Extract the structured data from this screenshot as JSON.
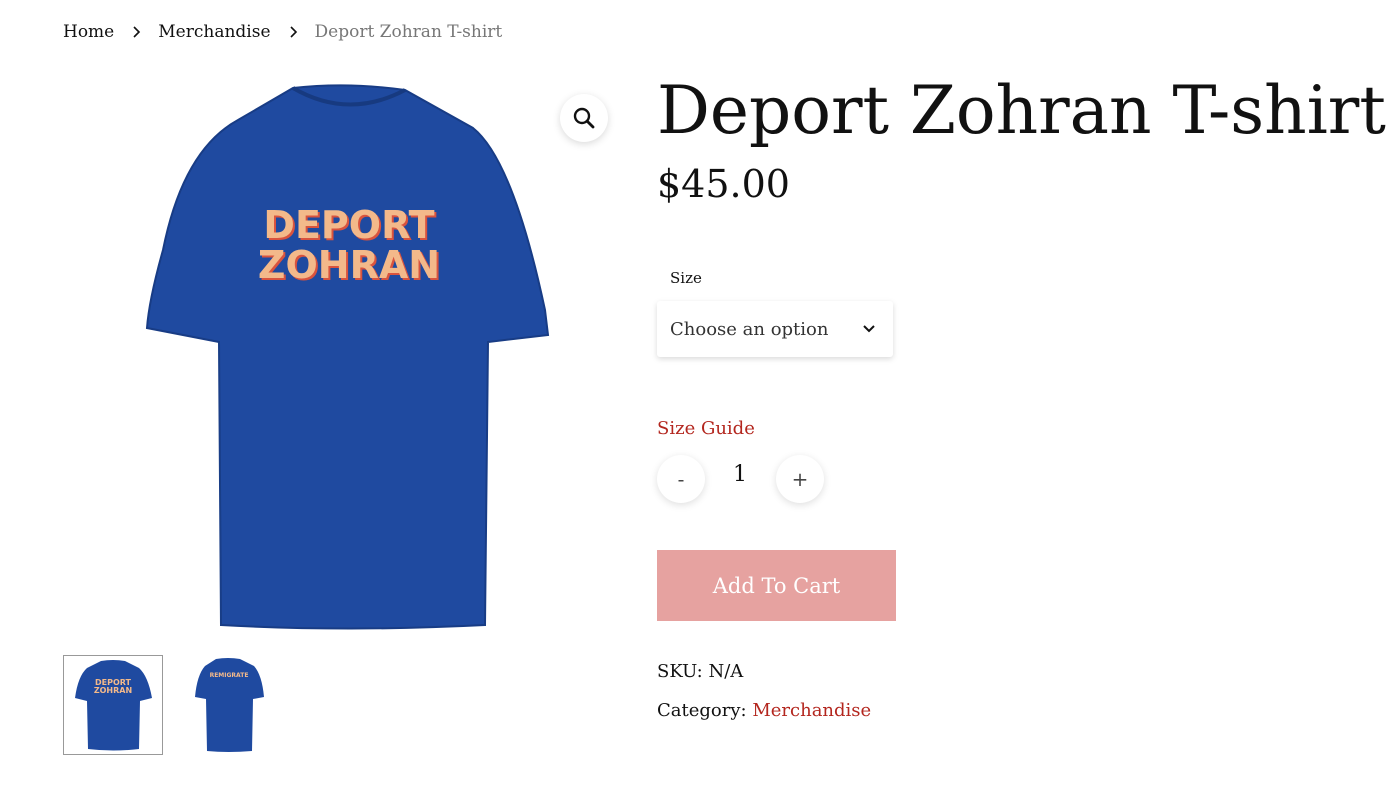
{
  "breadcrumb": {
    "home": "Home",
    "category": "Merchandise",
    "current": "Deport Zohran T-shirt"
  },
  "product": {
    "title": "Deport Zohran T-shirt",
    "price": "$45.00",
    "shirt_color": "#1f4aa0",
    "print_line1": "DEPORT",
    "print_line2": "ZOHRAN",
    "print_fill": "#f3b98a",
    "print_shadow": "#d9533e"
  },
  "thumbnails": [
    {
      "text1": "DEPORT",
      "text2": "ZOHRAN",
      "side": "front"
    },
    {
      "text1": "REMIGRATE",
      "text2": "",
      "side": "back"
    }
  ],
  "icons": {
    "zoom": "magnifier-icon",
    "dropdown": "chevron-down-icon",
    "breadcrumb_sep": "chevron-right-icon"
  },
  "size": {
    "label": "Size",
    "placeholder": "Choose an option"
  },
  "size_guide": "Size Guide",
  "quantity": {
    "minus": "-",
    "value": "1",
    "plus": "+"
  },
  "cart_button": "Add To Cart",
  "meta": {
    "sku_label": "SKU:",
    "sku_value": "N/A",
    "category_label": "Category:",
    "category_value": "Merchandise"
  },
  "colors": {
    "accent": "#b3261e",
    "cart_button": "#e6a2a0"
  }
}
